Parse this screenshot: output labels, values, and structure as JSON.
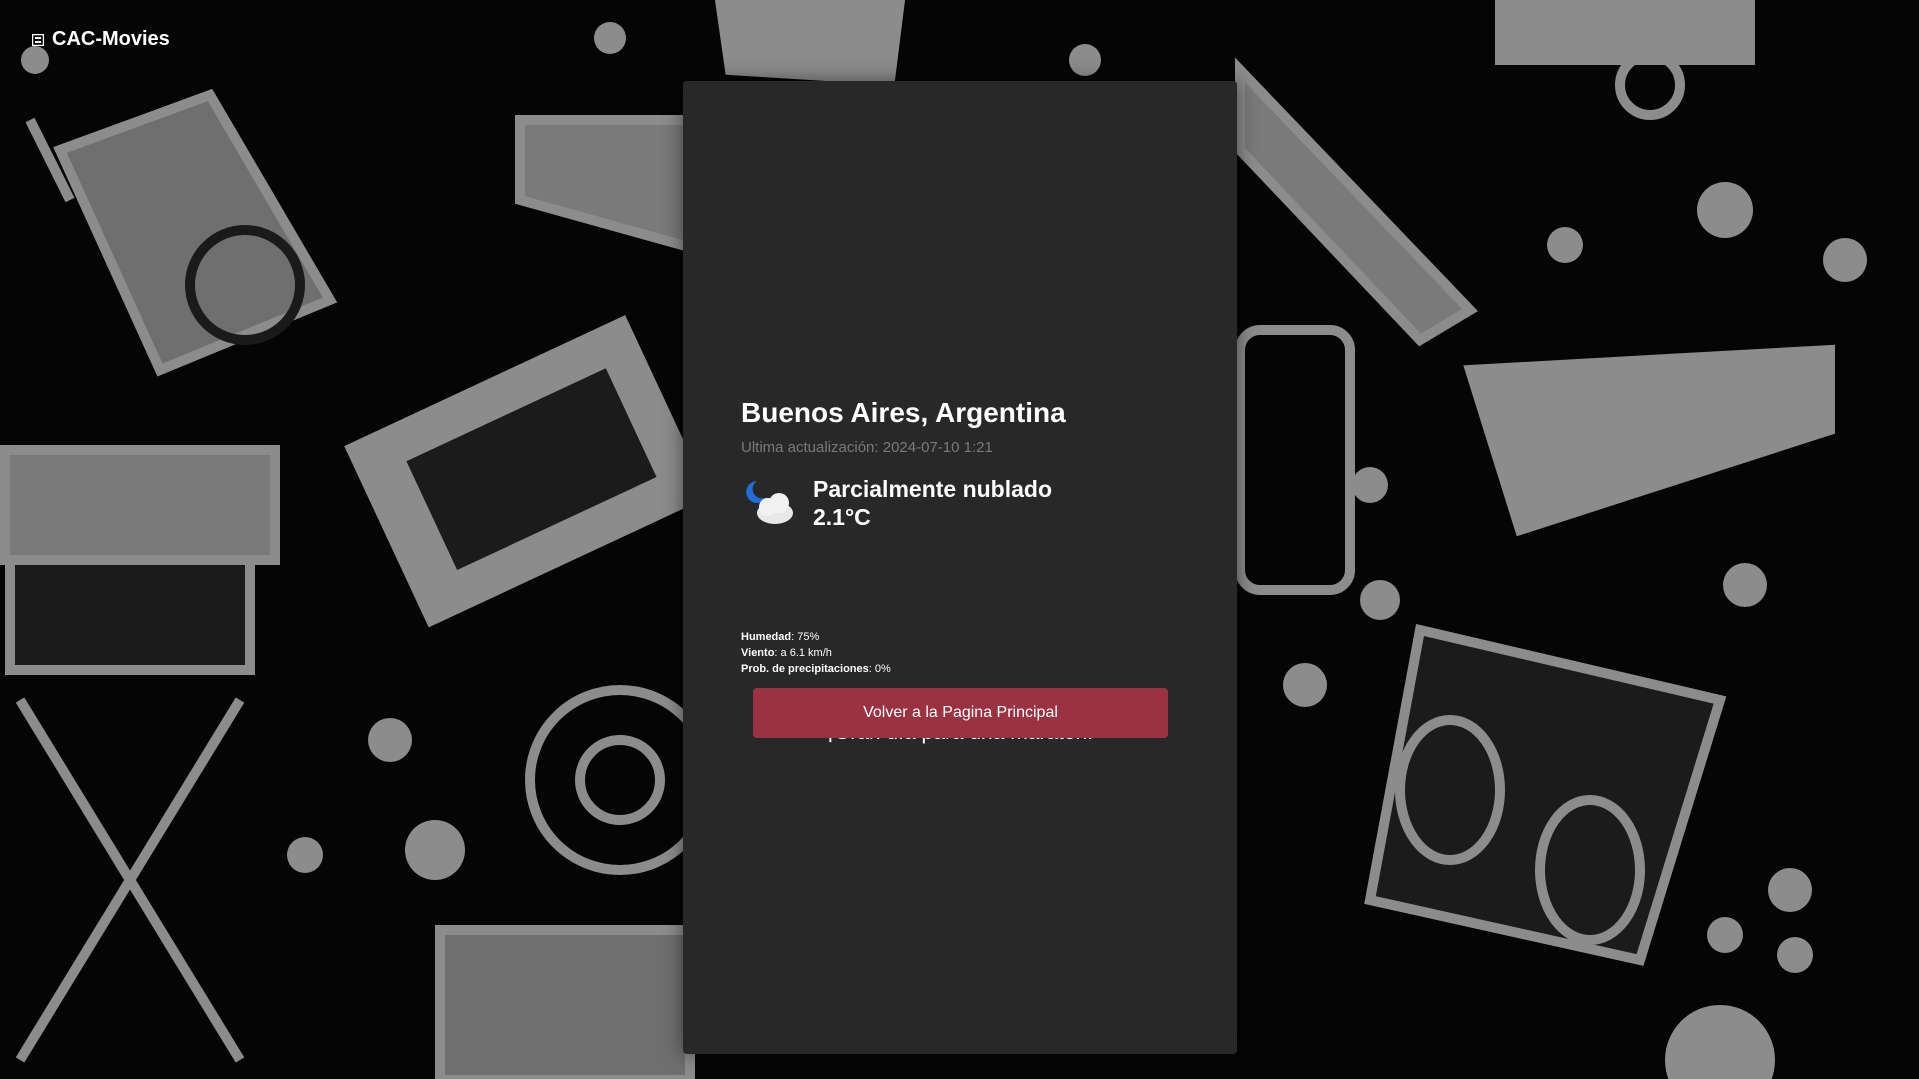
{
  "nav": {
    "brand": "CAC-Movies",
    "brand_icon": "film-icon"
  },
  "weather": {
    "location": "Buenos Aires, Argentina",
    "last_updated": "Ultima actualización: 2024-07-10 1:21",
    "icon": "partly-cloudy-night-icon",
    "condition": "Parcialmente nublado",
    "temperature": "2.1°C",
    "details": {
      "humidity_label": "Humedad",
      "humidity_value": ": 75%",
      "wind_label": "Viento",
      "wind_value": ": a 6.1 km/h",
      "precip_label": "Prob. de precipitaciones",
      "precip_value": ": 0%"
    },
    "message": "¡Gran día para una maratón!"
  },
  "actions": {
    "back_label": "Volver a la Pagina Principal"
  },
  "colors": {
    "background": "#050505",
    "card": "#282828",
    "accent_button": "#9b3242",
    "illustration": "#8c8c8c"
  }
}
